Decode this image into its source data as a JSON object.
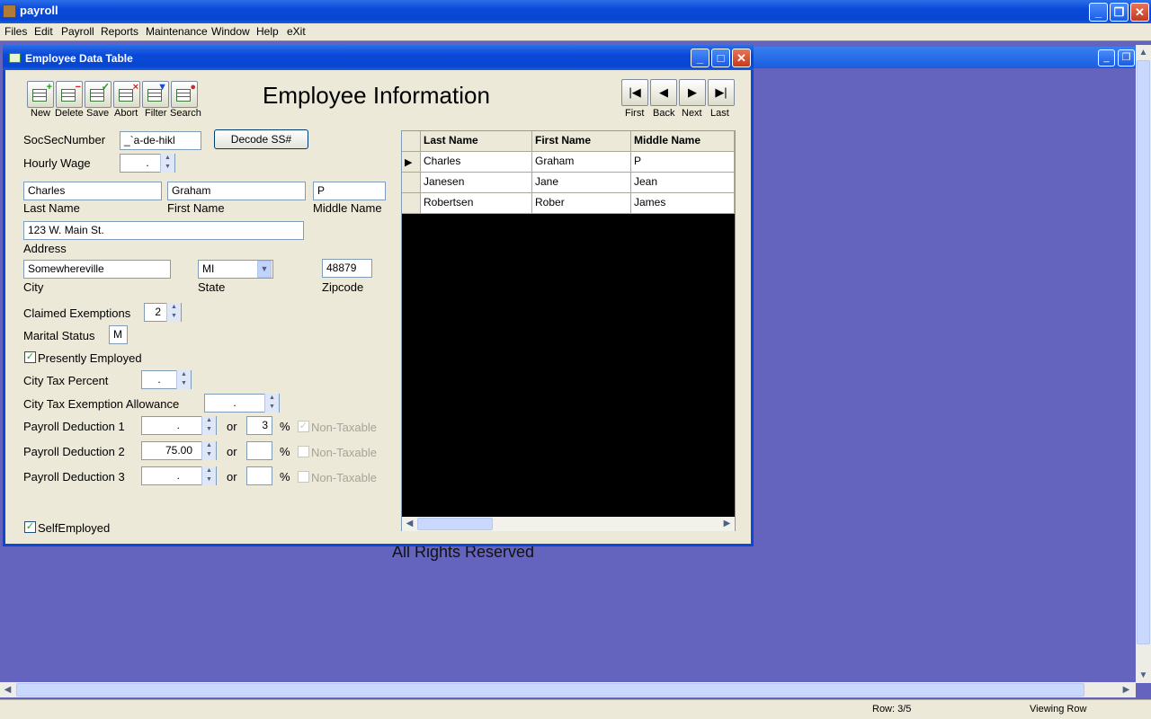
{
  "app": {
    "title": "payroll",
    "min": "_",
    "max": "❐",
    "close": "✕"
  },
  "menu": [
    "Files",
    "Edit",
    "Payroll",
    "Reports",
    "Maintenance",
    "Window",
    "Help",
    "eXit"
  ],
  "window": {
    "title": "Employee Data Table",
    "heading": "Employee Information",
    "min": "_",
    "max": "□",
    "close": "✕"
  },
  "toolbar": {
    "new": "New",
    "delete": "Delete",
    "save": "Save",
    "abort": "Abort",
    "filter": "Filter",
    "search": "Search"
  },
  "nav": {
    "first": "First",
    "back": "Back",
    "next": "Next",
    "last": "Last"
  },
  "form": {
    "ssn_label": "SocSecNumber",
    "ssn_value": "_`a-de-hikl",
    "decode_button": "Decode SS#",
    "wage_label": "Hourly Wage",
    "wage_value": ".",
    "last_name": "Charles",
    "first_name": "Graham",
    "middle_name": "P",
    "last_name_label": "Last Name",
    "first_name_label": "First Name",
    "middle_name_label": "Middle Name",
    "address": "123 W. Main St.",
    "address_label": "Address",
    "city": "Somewhereville",
    "state": "MI",
    "zip": "48879",
    "city_label": "City",
    "state_label": "State",
    "zip_label": "Zipcode",
    "exemptions_label": "Claimed Exemptions",
    "exemptions_value": "2",
    "marital_label": "Marital Status",
    "marital_value": "M",
    "employed_label": "Presently Employed",
    "employed_checked": true,
    "city_tax_label": "City Tax Percent",
    "city_tax_value": ".",
    "city_tax_allow_label": "City Tax Exemption Allowance",
    "city_tax_allow_value": ".",
    "deductions": [
      {
        "label": "Payroll Deduction 1",
        "amount": ".",
        "or": "or",
        "percent": "3",
        "pct": "%",
        "nontax": "Non-Taxable",
        "checked": true
      },
      {
        "label": "Payroll Deduction 2",
        "amount": "75.00",
        "or": "or",
        "percent": "",
        "pct": "%",
        "nontax": "Non-Taxable",
        "checked": false
      },
      {
        "label": "Payroll Deduction 3",
        "amount": ".",
        "or": "or",
        "percent": "",
        "pct": "%",
        "nontax": "Non-Taxable",
        "checked": false
      }
    ],
    "self_employed_label": "SelfEmployed",
    "self_employed_checked": true
  },
  "grid": {
    "columns": [
      "Last Name",
      "First Name",
      "Middle Name"
    ],
    "row_indicator": "▶",
    "rows": [
      [
        "Charles",
        "Graham",
        "P"
      ],
      [
        "Janesen",
        "Jane",
        "Jean"
      ],
      [
        "Robertsen",
        "Rober",
        "James"
      ]
    ]
  },
  "background_text": "All Rights Reserved",
  "status": {
    "row": "Row: 3/5",
    "mode": "Viewing Row"
  },
  "icons": {
    "check": "✓",
    "up": "▲",
    "down": "▼",
    "left": "◀",
    "right": "▶",
    "dropdown": "▼"
  },
  "colors": {
    "titlebar": "#0a48d8",
    "mdi_background": "#6464be",
    "grid_background": "#000000"
  }
}
